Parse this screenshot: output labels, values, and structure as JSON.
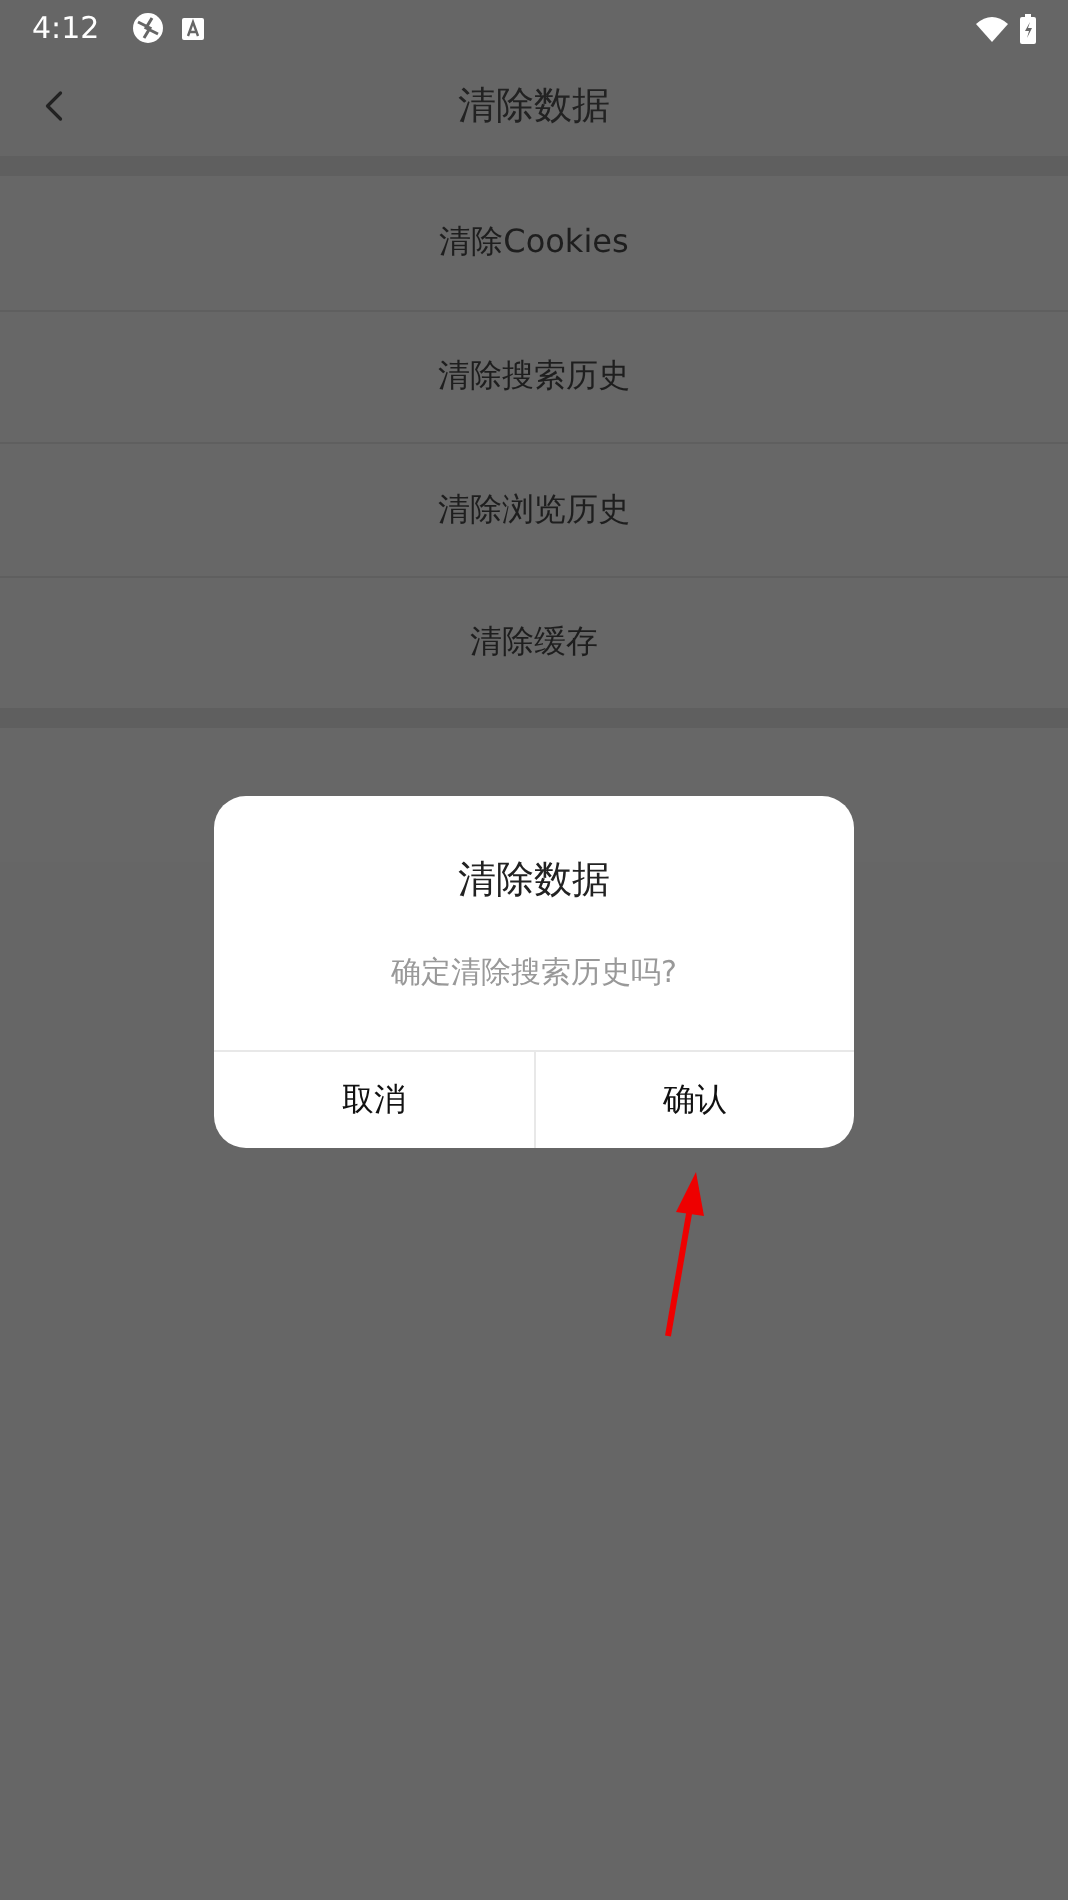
{
  "status_bar": {
    "time": "4:12"
  },
  "header": {
    "title": "清除数据"
  },
  "groups": [
    {
      "items": [
        {
          "label": "清除Cookies"
        },
        {
          "label": "清除搜索历史"
        },
        {
          "label": "清除浏览历史"
        },
        {
          "label": "清除缓存"
        }
      ]
    }
  ],
  "dialog": {
    "title": "清除数据",
    "message": "确定清除搜索历史吗?",
    "buttons": [
      {
        "label": "取消"
      },
      {
        "label": "确认"
      }
    ]
  }
}
